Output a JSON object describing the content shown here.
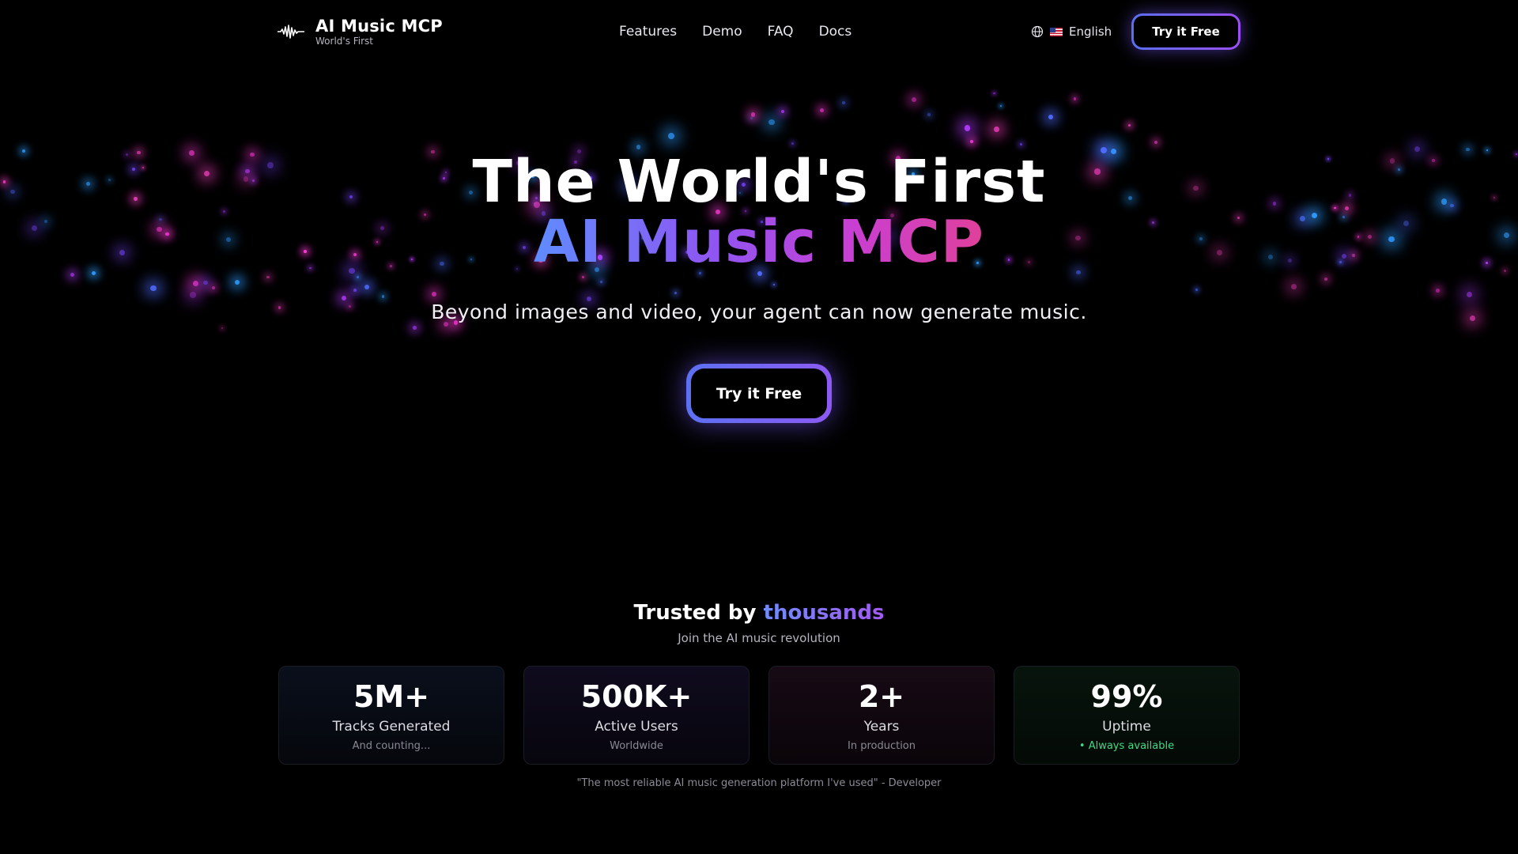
{
  "brand": {
    "title": "AI Music MCP",
    "subtitle": "World's First"
  },
  "nav": {
    "links": [
      "Features",
      "Demo",
      "FAQ",
      "Docs"
    ],
    "language": "English",
    "cta_label": "Try it Free"
  },
  "hero": {
    "title_line1": "The World's First",
    "title_line2": "AI Music MCP",
    "subtitle": "Beyond images and video, your agent can now generate music.",
    "cta_label": "Try it Free"
  },
  "trust": {
    "title_prefix": "Trusted by ",
    "title_highlight": "thousands",
    "subtitle": "Join the AI music revolution",
    "stats": [
      {
        "value": "5M+",
        "label": "Tracks Generated",
        "note": "And counting..."
      },
      {
        "value": "500K+",
        "label": "Active Users",
        "note": "Worldwide"
      },
      {
        "value": "2+",
        "label": "Years",
        "note": "In production"
      },
      {
        "value": "99%",
        "label": "Uptime",
        "note": "• Always available"
      }
    ],
    "quote": "\"The most reliable AI music generation platform I've used\" - Developer"
  },
  "colors": {
    "background": "#000000",
    "accent_blue": "#5f8cff",
    "accent_purple": "#8f55f2",
    "accent_pink": "#e0409a",
    "status_green": "#3ddc84"
  },
  "icons": [
    "waveform-logo-icon",
    "globe-icon",
    "us-flag-icon"
  ]
}
